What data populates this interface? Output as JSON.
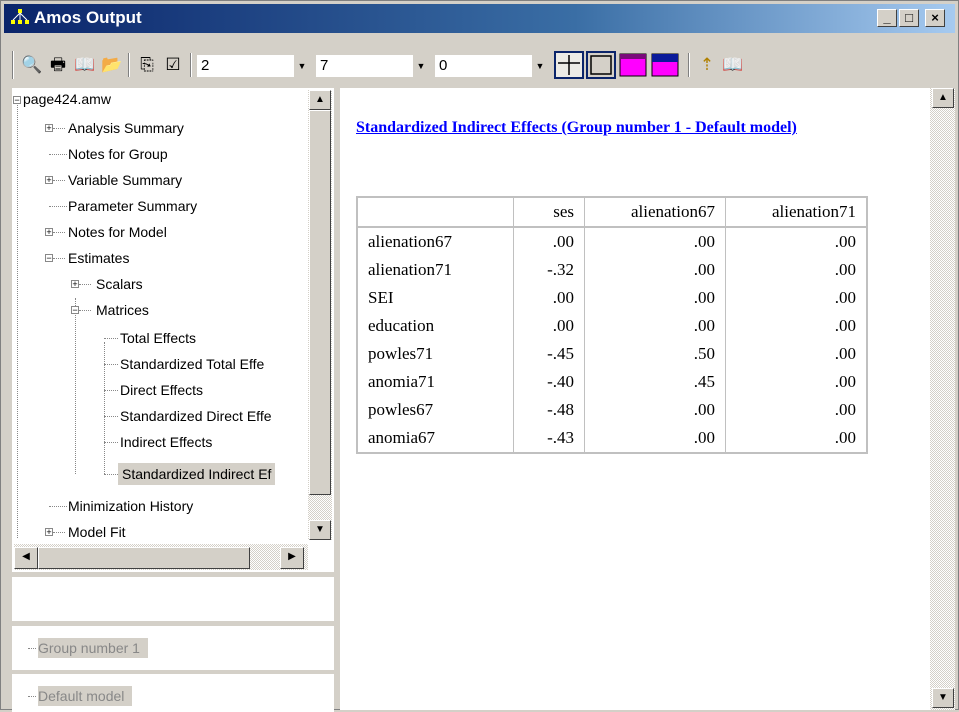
{
  "window": {
    "title": "Amos Output"
  },
  "caption_buttons": {
    "minimize": "_",
    "maximize": "□",
    "close": "×"
  },
  "toolbar": {
    "combo1_value": "2",
    "combo2_value": "7",
    "combo3_value": "0"
  },
  "tree": {
    "root": "page424.amw",
    "items": [
      "Analysis Summary",
      "Notes for Group",
      "Variable Summary",
      "Parameter Summary",
      "Notes for Model",
      "Estimates",
      "Scalars",
      "Matrices",
      "Total Effects",
      "Standardized Total Effe",
      "Direct Effects",
      "Standardized Direct Effe",
      "Indirect Effects",
      "Standardized Indirect Ef",
      "Minimization History",
      "Model Fit"
    ]
  },
  "group_panel": {
    "label": "Group number 1"
  },
  "model_panel": {
    "label": "Default model"
  },
  "report": {
    "heading": "Standardized Indirect Effects (Group number 1 - Default model)",
    "columns": [
      "ses",
      "alienation67",
      "alienation71"
    ],
    "rows": [
      {
        "label": "alienation67",
        "values": [
          ".00",
          ".00",
          ".00"
        ]
      },
      {
        "label": "alienation71",
        "values": [
          "-.32",
          ".00",
          ".00"
        ]
      },
      {
        "label": "SEI",
        "values": [
          ".00",
          ".00",
          ".00"
        ]
      },
      {
        "label": "education",
        "values": [
          ".00",
          ".00",
          ".00"
        ]
      },
      {
        "label": "powles71",
        "values": [
          "-.45",
          ".50",
          ".00"
        ]
      },
      {
        "label": "anomia71",
        "values": [
          "-.40",
          ".45",
          ".00"
        ]
      },
      {
        "label": "powles67",
        "values": [
          "-.48",
          ".00",
          ".00"
        ]
      },
      {
        "label": "anomia67",
        "values": [
          "-.43",
          ".00",
          ".00"
        ]
      }
    ]
  }
}
